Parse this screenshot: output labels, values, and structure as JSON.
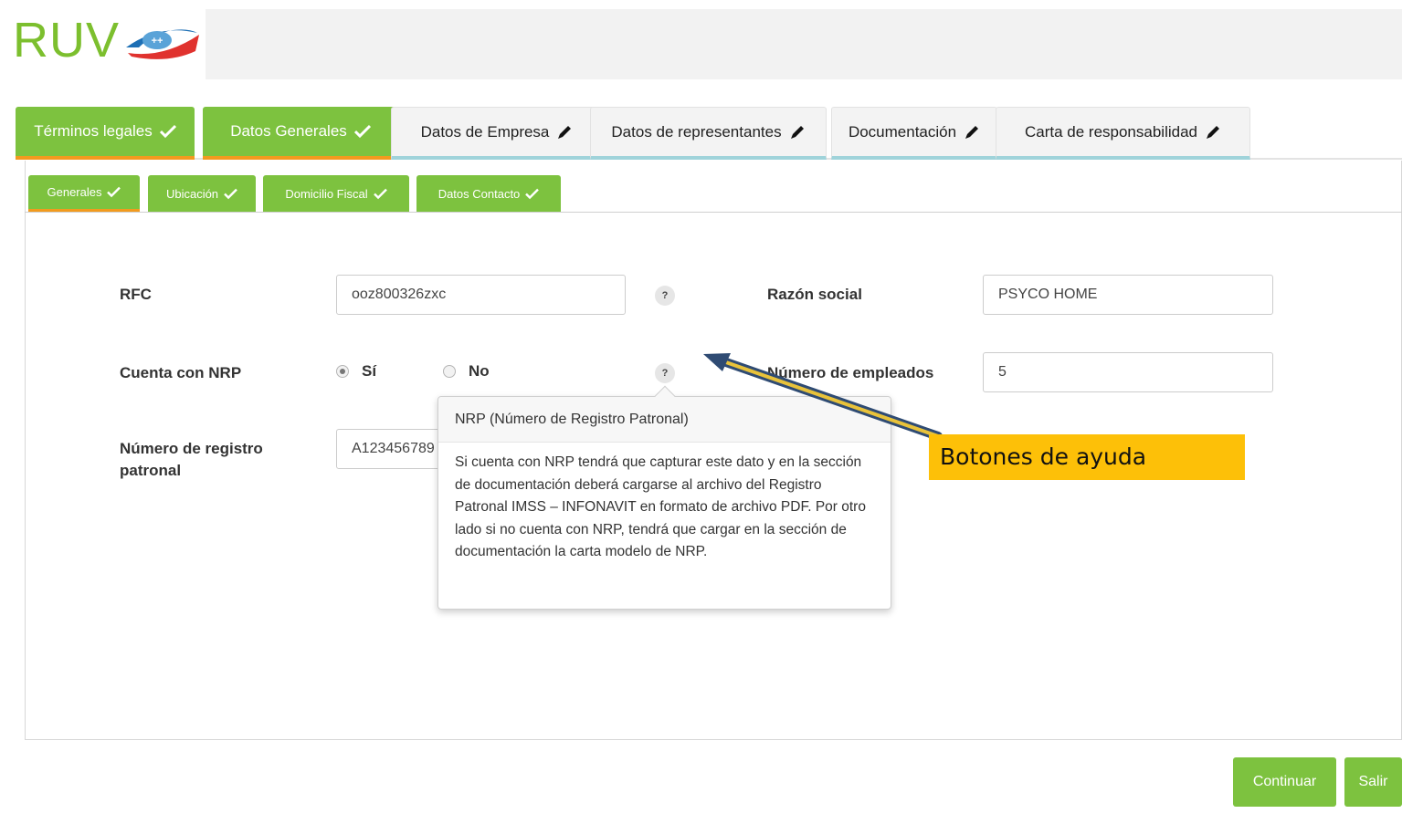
{
  "logo": {
    "text": "RUV",
    "badge": "++"
  },
  "main_tabs": [
    {
      "label": "Términos legales",
      "status": "done",
      "icon": "check-icon"
    },
    {
      "label": "Datos Generales",
      "status": "done",
      "icon": "check-icon"
    },
    {
      "label": "Datos de Empresa",
      "status": "pending",
      "icon": "pencil-icon"
    },
    {
      "label": "Datos de representantes",
      "status": "pending",
      "icon": "pencil-icon"
    },
    {
      "label": "Documentación",
      "status": "pending",
      "icon": "pencil-icon"
    },
    {
      "label": "Carta de responsabilidad",
      "status": "pending",
      "icon": "pencil-icon"
    }
  ],
  "sub_tabs": [
    {
      "label": "Generales",
      "active": true,
      "icon": "check-icon"
    },
    {
      "label": "Ubicación",
      "active": false,
      "icon": "check-icon"
    },
    {
      "label": "Domicilio Fiscal",
      "active": false,
      "icon": "check-icon"
    },
    {
      "label": "Datos Contacto",
      "active": false,
      "icon": "check-icon"
    }
  ],
  "form": {
    "rfc_label": "RFC",
    "rfc_value": "ooz800326zxc",
    "razon_label": "Razón social",
    "razon_value": "PSYCO HOME",
    "nrp_label": "Cuenta con NRP",
    "nrp_yes": "Sí",
    "nrp_no": "No",
    "nrp_selected": "Sí",
    "empleados_label": "Número de empleados",
    "empleados_value": "5",
    "registro_label": "Número de registro patronal",
    "registro_value": "A123456789",
    "help_glyph": "?"
  },
  "tooltip": {
    "title": "NRP (Número de Registro Patronal)",
    "body": "Si cuenta con NRP tendrá que capturar este dato y en la sección de documentación deberá cargarse al archivo del Registro Patronal IMSS – INFONAVIT en formato de archivo PDF. Por otro lado si no cuenta con NRP, tendrá que cargar en la sección de documentación la carta modelo de NRP."
  },
  "callout": {
    "text": "Botones de ayuda"
  },
  "buttons": {
    "continue": "Continuar",
    "exit": "Salir"
  },
  "colors": {
    "green": "#7dc23f",
    "orange_underline": "#f29a1e",
    "teal_underline": "#9fd3da",
    "callout": "#fdc008",
    "arrow": "#2f4b73"
  }
}
